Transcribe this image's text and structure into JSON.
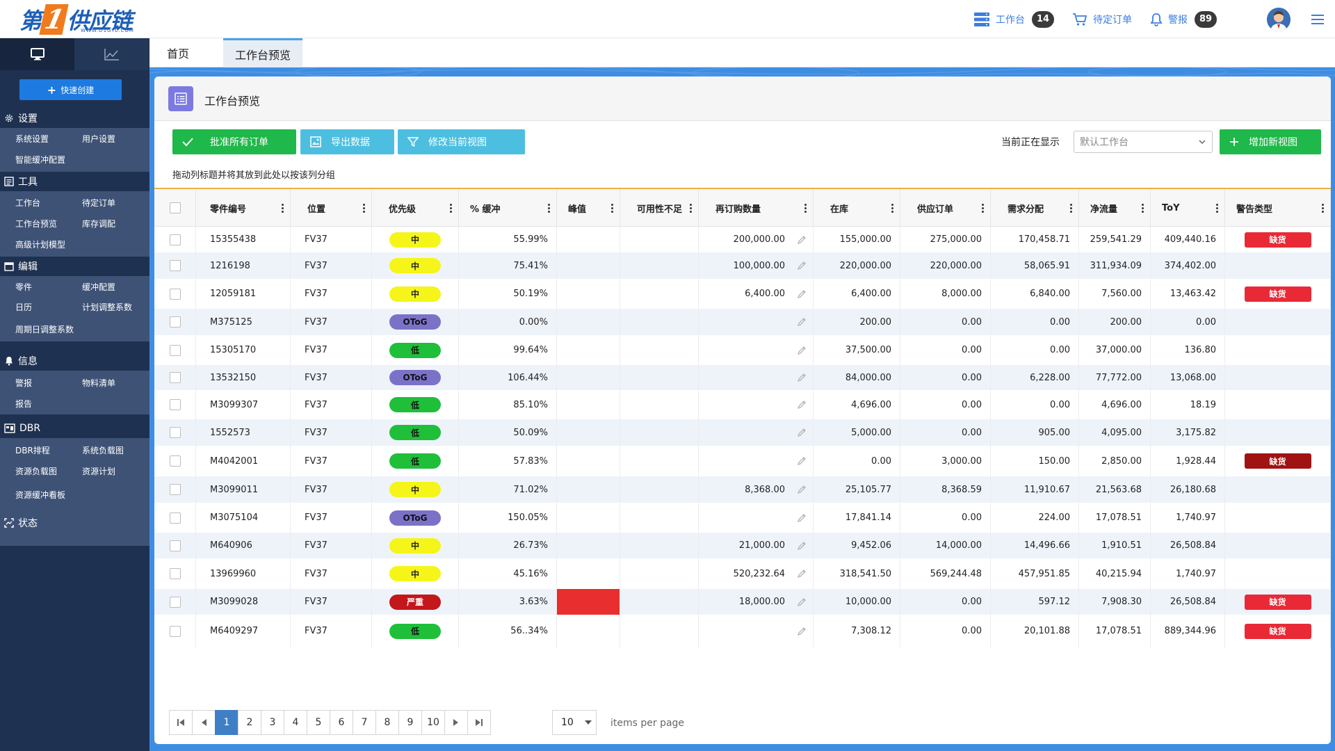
{
  "header": {
    "logo_char": "第",
    "logo_one": "1",
    "logo_rest": "供应链",
    "logo_sub": "WWW.D1GYL.COM",
    "workbench_label": "工作台",
    "workbench_count": "14",
    "pending_orders_label": "待定订单",
    "alerts_label": "警报",
    "alerts_count": "89"
  },
  "sidebar": {
    "quick_create": "快速创建",
    "sections": [
      {
        "title": "设置",
        "items": [
          "系统设置",
          "用户设置",
          "智能缓冲配置"
        ]
      },
      {
        "title": "工具",
        "items": [
          "工作台",
          "待定订单",
          "工作台预览",
          "库存调配",
          "高级计划模型"
        ]
      },
      {
        "title": "编辑",
        "items": [
          "零件",
          "缓冲配置",
          "日历",
          "计划调整系数",
          "周期日调整系数"
        ]
      },
      {
        "title": "信息",
        "items": [
          "警报",
          "物料清单",
          "报告"
        ]
      },
      {
        "title": "DBR",
        "items": [
          "DBR排程",
          "系统负载图",
          "资源负载图",
          "资源计划",
          "资源缓冲看板"
        ]
      },
      {
        "title": "状态",
        "items": []
      }
    ]
  },
  "tabs": [
    "首页",
    "工作台预览"
  ],
  "card": {
    "title": "工作台预览",
    "approve_all": "批准所有订单",
    "export": "导出数据",
    "modify_view": "修改当前视图",
    "showing_label": "当前正在显示",
    "select_value": "默认工作台",
    "add_view": "增加新视图",
    "group_hint": "拖动列标题并将其放到此处以按该列分组"
  },
  "table": {
    "columns": [
      "零件编号",
      "位置",
      "优先级",
      "% 缓冲",
      "峰值",
      "可用性不足",
      "再订购数量",
      "在库",
      "供应订单",
      "需求分配",
      "净流量",
      "ToY",
      "警告类型"
    ],
    "rows": [
      {
        "part": "15355438",
        "loc": "FV37",
        "priority": "中",
        "ptype": "mid",
        "buffer": "55.99%",
        "peak": "",
        "shortage": "",
        "reorder": "200,000.00",
        "onhand": "155,000.00",
        "supply": "275,000.00",
        "demand": "170,458.71",
        "netflow": "259,541.29",
        "toy": "409,440.16",
        "warn": "缺货",
        "wtype": "red"
      },
      {
        "part": "1216198",
        "loc": "FV37",
        "priority": "中",
        "ptype": "mid",
        "buffer": "75.41%",
        "peak": "",
        "shortage": "",
        "reorder": "100,000.00",
        "onhand": "220,000.00",
        "supply": "220,000.00",
        "demand": "58,065.91",
        "netflow": "311,934.09",
        "toy": "374,402.00",
        "warn": "",
        "wtype": ""
      },
      {
        "part": "12059181",
        "loc": "FV37",
        "priority": "中",
        "ptype": "mid",
        "buffer": "50.19%",
        "peak": "",
        "shortage": "",
        "reorder": "6,400.00",
        "onhand": "6,400.00",
        "supply": "8,000.00",
        "demand": "6,840.00",
        "netflow": "7,560.00",
        "toy": "13,463.42",
        "warn": "缺货",
        "wtype": "red"
      },
      {
        "part": "M375125",
        "loc": "FV37",
        "priority": "OToG",
        "ptype": "otog",
        "buffer": "0.00%",
        "peak": "",
        "shortage": "",
        "reorder": "",
        "onhand": "200.00",
        "supply": "0.00",
        "demand": "0.00",
        "netflow": "200.00",
        "toy": "0.00",
        "warn": "",
        "wtype": ""
      },
      {
        "part": "15305170",
        "loc": "FV37",
        "priority": "低",
        "ptype": "low",
        "buffer": "99.64%",
        "peak": "",
        "shortage": "",
        "reorder": "",
        "onhand": "37,500.00",
        "supply": "0.00",
        "demand": "0.00",
        "netflow": "37,000.00",
        "toy": "136.80",
        "warn": "",
        "wtype": ""
      },
      {
        "part": "13532150",
        "loc": "FV37",
        "priority": "OToG",
        "ptype": "otog",
        "buffer": "106.44%",
        "peak": "",
        "shortage": "",
        "reorder": "",
        "onhand": "84,000.00",
        "supply": "0.00",
        "demand": "6,228.00",
        "netflow": "77,772.00",
        "toy": "13,068.00",
        "warn": "",
        "wtype": ""
      },
      {
        "part": "M3099307",
        "loc": "FV37",
        "priority": "低",
        "ptype": "low",
        "buffer": "85.10%",
        "peak": "",
        "shortage": "",
        "reorder": "",
        "onhand": "4,696.00",
        "supply": "0.00",
        "demand": "0.00",
        "netflow": "4,696.00",
        "toy": "18.19",
        "warn": "",
        "wtype": ""
      },
      {
        "part": "1552573",
        "loc": "FV37",
        "priority": "低",
        "ptype": "low",
        "buffer": "50.09%",
        "peak": "",
        "shortage": "",
        "reorder": "",
        "onhand": "5,000.00",
        "supply": "0.00",
        "demand": "905.00",
        "netflow": "4,095.00",
        "toy": "3,175.82",
        "warn": "",
        "wtype": ""
      },
      {
        "part": "M4042001",
        "loc": "FV37",
        "priority": "低",
        "ptype": "low",
        "buffer": "57.83%",
        "peak": "",
        "shortage": "",
        "reorder": "",
        "onhand": "0.00",
        "supply": "3,000.00",
        "demand": "150.00",
        "netflow": "2,850.00",
        "toy": "1,928.44",
        "warn": "缺货",
        "wtype": "dark"
      },
      {
        "part": "M3099011",
        "loc": "FV37",
        "priority": "中",
        "ptype": "mid",
        "buffer": "71.02%",
        "peak": "",
        "shortage": "",
        "reorder": "8,368.00",
        "onhand": "25,105.77",
        "supply": "8,368.59",
        "demand": "11,910.67",
        "netflow": "21,563.68",
        "toy": "26,180.68",
        "warn": "",
        "wtype": ""
      },
      {
        "part": "M3075104",
        "loc": "FV37",
        "priority": "OToG",
        "ptype": "otog",
        "buffer": "150.05%",
        "peak": "",
        "shortage": "",
        "reorder": "",
        "onhand": "17,841.14",
        "supply": "0.00",
        "demand": "224.00",
        "netflow": "17,078.51",
        "toy": "1,740.97",
        "warn": "",
        "wtype": ""
      },
      {
        "part": "M640906",
        "loc": "FV37",
        "priority": "中",
        "ptype": "mid",
        "buffer": "26.73%",
        "peak": "",
        "shortage": "",
        "reorder": "21,000.00",
        "onhand": "9,452.06",
        "supply": "14,000.00",
        "demand": "14,496.66",
        "netflow": "1,910.51",
        "toy": "26,508.84",
        "warn": "",
        "wtype": ""
      },
      {
        "part": "13969960",
        "loc": "FV37",
        "priority": "中",
        "ptype": "mid",
        "buffer": "45.16%",
        "peak": "",
        "shortage": "",
        "reorder": "520,232.64",
        "onhand": "318,541.50",
        "supply": "569,244.48",
        "demand": "457,951.85",
        "netflow": "40,215.94",
        "toy": "1,740.97",
        "warn": "",
        "wtype": ""
      },
      {
        "part": "M3099028",
        "loc": "FV37",
        "priority": "严重",
        "ptype": "sev",
        "buffer": "3.63%",
        "peak": "",
        "peak_flag": "#e82e2e",
        "shortage": "",
        "reorder": "18,000.00",
        "onhand": "10,000.00",
        "supply": "0.00",
        "demand": "597.12",
        "netflow": "7,908.30",
        "toy": "26,508.84",
        "warn": "缺货",
        "wtype": "red"
      },
      {
        "part": "M6409297",
        "loc": "FV37",
        "priority": "低",
        "ptype": "low",
        "buffer": "56..34%",
        "peak": "",
        "shortage": "",
        "reorder": "",
        "onhand": "7,308.12",
        "supply": "0.00",
        "demand": "20,101.88",
        "netflow": "17,078.51",
        "toy": "889,344.96",
        "warn": "缺货",
        "wtype": "red"
      }
    ]
  },
  "pager": {
    "pages": [
      "1",
      "2",
      "3",
      "4",
      "5",
      "6",
      "7",
      "8",
      "9",
      "10"
    ],
    "current": "1",
    "per_page": "10",
    "per_page_label": "items per page"
  }
}
